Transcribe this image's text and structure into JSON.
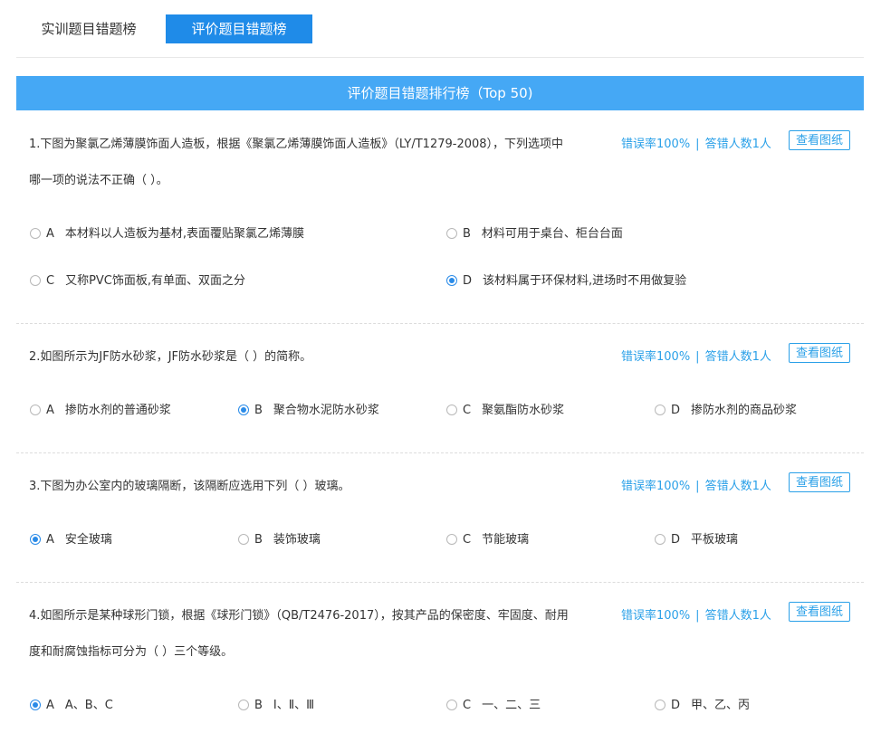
{
  "tabs": [
    {
      "label": "实训题目错题榜",
      "active": false
    },
    {
      "label": "评价题目错题榜",
      "active": true
    }
  ],
  "banner": {
    "title": "评价题目错题排行榜（Top 50)"
  },
  "colors": {
    "accent": "#1f8be8",
    "banner": "#45a8f5",
    "link": "#2aa0e8"
  },
  "view_label": "查看图纸",
  "questions": [
    {
      "text": "1.下图为聚氯乙烯薄膜饰面人造板，根据《聚氯乙烯薄膜饰面人造板》（LY/T1279-2008），下列选项中哪一项的说法不正确（ ）。",
      "error_rate": "错误率100%",
      "wrong_count": "答错人数1人",
      "options": [
        {
          "letter": "A",
          "text": "本材料以人造板为基材,表面覆贴聚氯乙烯薄膜",
          "selected": false
        },
        {
          "letter": "B",
          "text": "材料可用于桌台、柜台台面",
          "selected": false
        },
        {
          "letter": "C",
          "text": "又称PVC饰面板,有单面、双面之分",
          "selected": false
        },
        {
          "letter": "D",
          "text": "该材料属于环保材料,进场时不用做复验",
          "selected": true
        }
      ]
    },
    {
      "text": "2.如图所示为JF防水砂浆，JF防水砂浆是（ ）的简称。",
      "error_rate": "错误率100%",
      "wrong_count": "答错人数1人",
      "options": [
        {
          "letter": "A",
          "text": "掺防水剂的普通砂浆",
          "selected": false
        },
        {
          "letter": "B",
          "text": "聚合物水泥防水砂浆",
          "selected": true
        },
        {
          "letter": "C",
          "text": "聚氨酯防水砂浆",
          "selected": false
        },
        {
          "letter": "D",
          "text": "掺防水剂的商品砂浆",
          "selected": false
        }
      ]
    },
    {
      "text": "3.下图为办公室内的玻璃隔断，该隔断应选用下列（ ）玻璃。",
      "error_rate": "错误率100%",
      "wrong_count": "答错人数1人",
      "options": [
        {
          "letter": "A",
          "text": "安全玻璃",
          "selected": true
        },
        {
          "letter": "B",
          "text": "装饰玻璃",
          "selected": false
        },
        {
          "letter": "C",
          "text": "节能玻璃",
          "selected": false
        },
        {
          "letter": "D",
          "text": "平板玻璃",
          "selected": false
        }
      ]
    },
    {
      "text": "4.如图所示是某种球形门锁，根据《球形门锁》（QB/T2476-2017），按其产品的保密度、牢固度、耐用度和耐腐蚀指标可分为（ ）三个等级。",
      "error_rate": "错误率100%",
      "wrong_count": "答错人数1人",
      "options": [
        {
          "letter": "A",
          "text": "A、B、C",
          "selected": true
        },
        {
          "letter": "B",
          "text": "Ⅰ、Ⅱ、Ⅲ",
          "selected": false
        },
        {
          "letter": "C",
          "text": "一、二、三",
          "selected": false
        },
        {
          "letter": "D",
          "text": "甲、乙、丙",
          "selected": false
        }
      ]
    }
  ]
}
